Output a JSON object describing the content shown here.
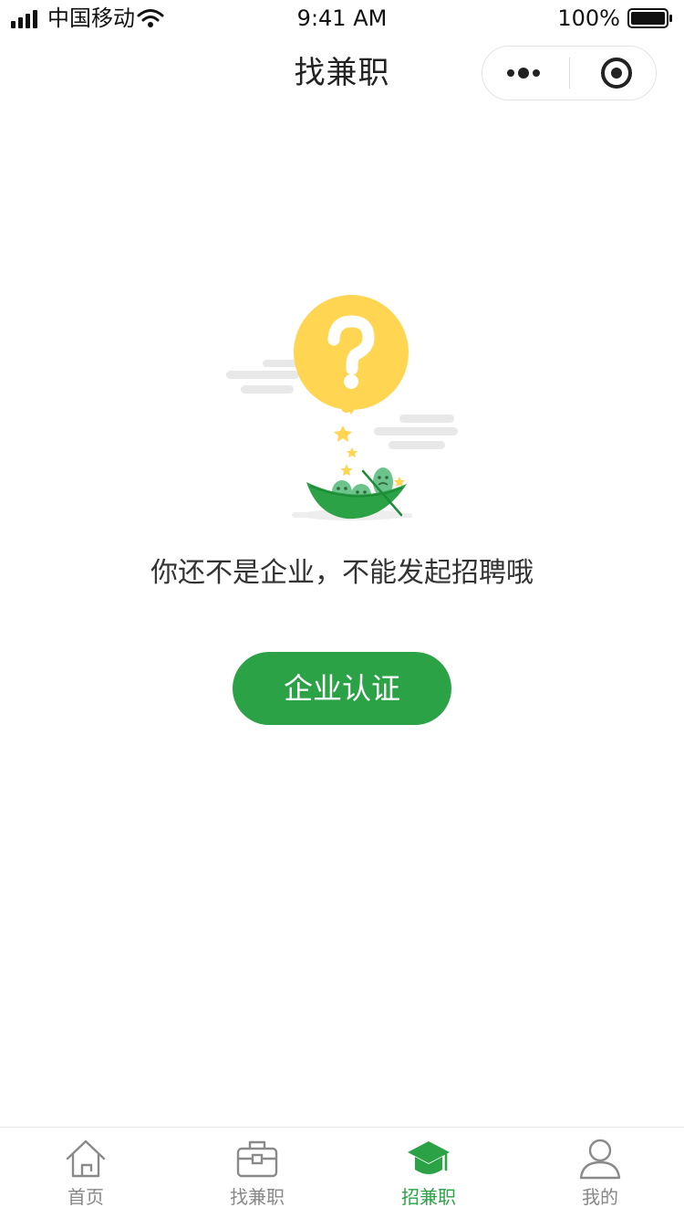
{
  "status_bar": {
    "carrier": "中国移动",
    "time": "9:41 AM",
    "battery": "100%"
  },
  "nav": {
    "title": "找兼职"
  },
  "empty_state": {
    "message": "你还不是企业，不能发起招聘哦",
    "button_label": "企业认证"
  },
  "tab_bar": {
    "active_color": "#2ba245",
    "inactive_color": "#888888",
    "tabs": [
      {
        "label": "首页",
        "icon": "home-icon",
        "active": false
      },
      {
        "label": "找兼职",
        "icon": "briefcase-icon",
        "active": false
      },
      {
        "label": "招兼职",
        "icon": "graduation-cap-icon",
        "active": true
      },
      {
        "label": "我的",
        "icon": "user-icon",
        "active": false
      }
    ]
  },
  "colors": {
    "brand": "#2ba245",
    "question_bubble": "#ffd552"
  }
}
